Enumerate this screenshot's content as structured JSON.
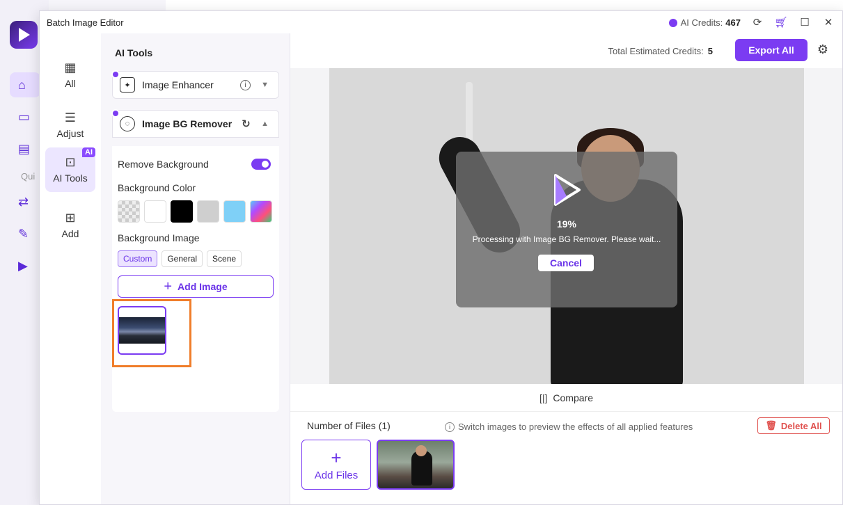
{
  "background": {
    "quick_label": "Qui"
  },
  "window": {
    "title": "Batch Image Editor",
    "credits_label": "AI Credits:",
    "credits_value": "467"
  },
  "rail": {
    "items": [
      {
        "label": "All",
        "icon": "grid-icon"
      },
      {
        "label": "Adjust",
        "icon": "sliders-icon"
      },
      {
        "label": "AI Tools",
        "icon": "ai-icon",
        "badge": "AI"
      },
      {
        "label": "Add",
        "icon": "plus-square-icon"
      }
    ]
  },
  "panel": {
    "heading": "AI Tools",
    "enhancer_label": "Image Enhancer",
    "bg_remover_label": "Image BG Remover",
    "remove_bg_label": "Remove Background",
    "remove_bg_on": true,
    "bg_color_label": "Background Color",
    "bg_image_label": "Background Image",
    "chips": [
      "Custom",
      "General",
      "Scene"
    ],
    "active_chip": "Custom",
    "add_image_label": "Add Image"
  },
  "main": {
    "estimated_label": "Total Estimated Credits:",
    "estimated_value": "5",
    "export_label": "Export All",
    "progress_percent": "19%",
    "processing_message": "Processing with Image BG Remover. Please wait...",
    "cancel_label": "Cancel",
    "compare_label": "Compare"
  },
  "files": {
    "count_label": "Number of Files (1)",
    "hint": "Switch images to preview the effects of all applied features",
    "delete_label": "Delete All",
    "add_files_label": "Add Files"
  },
  "colors": {
    "accent": "#7b3cf2",
    "danger": "#e0524f",
    "highlight": "#f07d2a"
  }
}
